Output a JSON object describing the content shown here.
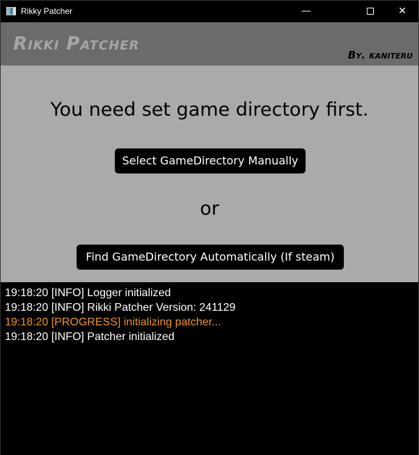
{
  "window": {
    "title": "Rikky Patcher",
    "minimize_icon": "minimize-icon",
    "maximize_icon": "maximize-icon",
    "close_icon": "close-icon"
  },
  "header": {
    "brand": "Rikki Patcher",
    "author": "By. kaniteru"
  },
  "main": {
    "message": "You need set game directory first.",
    "manual_button": "Select GameDirectory Manually",
    "or_label": "or",
    "auto_button": "Find GameDirectory Automatically (If steam)"
  },
  "log": {
    "lines": [
      {
        "text": "19:18:20 [INFO] Logger initialized",
        "level": "INFO"
      },
      {
        "text": "19:18:20 [INFO] Rikki Patcher Version: 241129",
        "level": "INFO"
      },
      {
        "text": "19:18:20 [PROGRESS] initializing patcher...",
        "level": "PROGRESS"
      },
      {
        "text": "19:18:20 [INFO] Patcher initialized",
        "level": "INFO"
      }
    ]
  },
  "colors": {
    "header_bg": "#6b6b6b",
    "main_bg": "#aaaaaa",
    "progress": "#f0961e",
    "info": "#ffffff"
  }
}
